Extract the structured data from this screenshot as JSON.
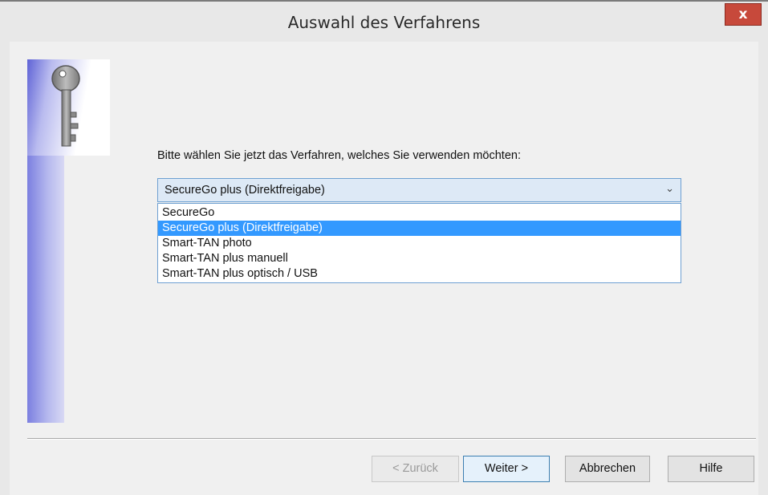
{
  "window": {
    "title": "Auswahl des Verfahrens",
    "close_label": "x"
  },
  "main": {
    "prompt": "Bitte wählen Sie jetzt das Verfahren, welches Sie verwenden möchten:",
    "combo": {
      "value": "SecureGo plus (Direktfreigabe)",
      "arrow": "⌄",
      "options": [
        "SecureGo",
        "SecureGo plus (Direktfreigabe)",
        "Smart-TAN photo",
        "Smart-TAN plus manuell",
        "Smart-TAN plus optisch / USB"
      ],
      "selected_index": 1
    },
    "sidebar_icon": "key-icon"
  },
  "buttons": {
    "back": "< Zurück",
    "next": "Weiter >",
    "cancel": "Abbrechen",
    "help": "Hilfe"
  },
  "colors": {
    "close": "#c7493b",
    "selection": "#3399ff",
    "sidebar": "#7b7fe0"
  }
}
